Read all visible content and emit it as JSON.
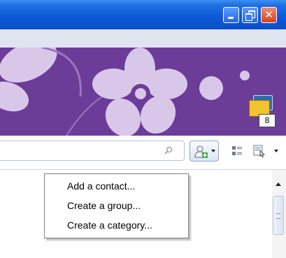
{
  "window": {
    "controls": [
      "minimize",
      "maximize",
      "close"
    ],
    "close_glyph": "✕"
  },
  "notifications": {
    "count": "8",
    "icon": "notification-cards-icon"
  },
  "toolbar": {
    "search_icon": "search-icon",
    "add_contact_icon": "add-contact-icon",
    "contact_list_icon": "contact-list-icon",
    "layout_icon": "layout-icon"
  },
  "context_menu": {
    "items": [
      {
        "label": "Add a contact..."
      },
      {
        "label": "Create a group..."
      },
      {
        "label": "Create a category..."
      }
    ]
  },
  "colors": {
    "titlebar": "#0d5ad6",
    "banner": "#6b3c98",
    "banner_flower": "#d9c7ea",
    "close_button": "#d5421f"
  }
}
